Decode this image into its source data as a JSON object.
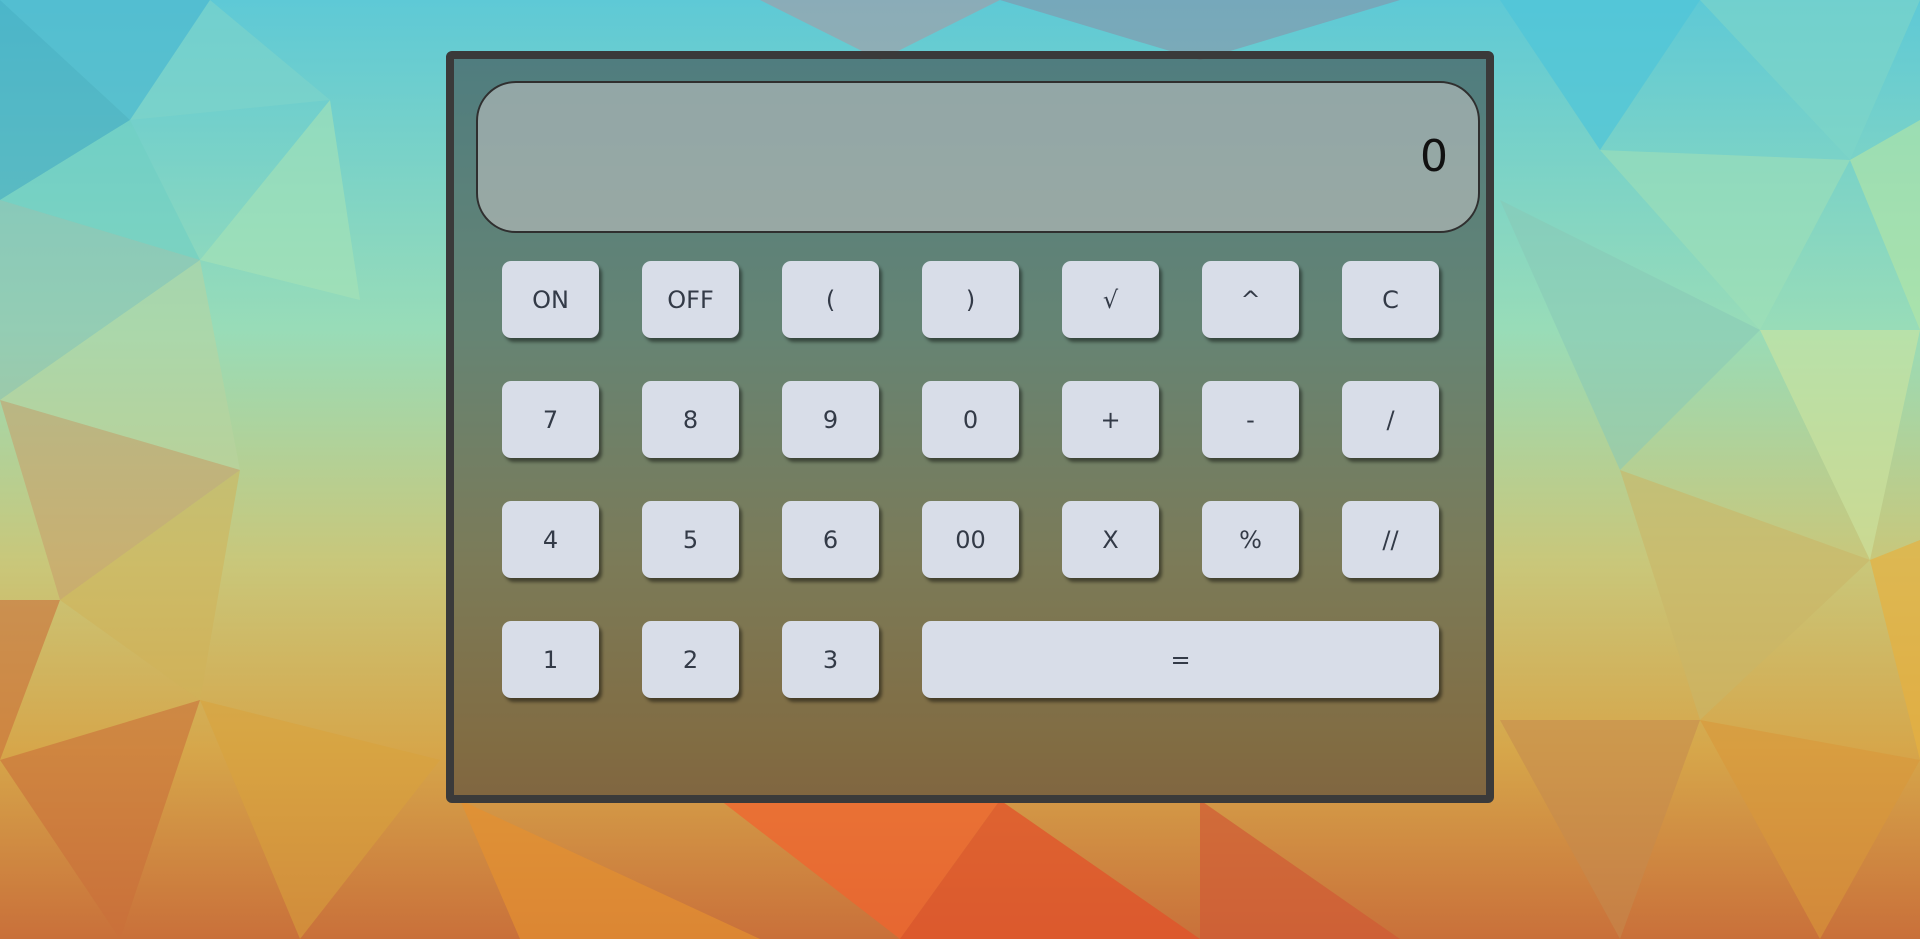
{
  "colors": {
    "frame": "#3a3a3a",
    "panel": "rgba(60,60,60,0.55)",
    "display_bg": "rgba(200,200,200,0.55)",
    "key_bg": "#d8dde8",
    "key_text": "#333a47"
  },
  "calculator": {
    "display_value": "0",
    "rows": [
      [
        "ON",
        "OFF",
        "(",
        ")",
        "√",
        "^",
        "C"
      ],
      [
        "7",
        "8",
        "9",
        "0",
        "+",
        "-",
        "/"
      ],
      [
        "4",
        "5",
        "6",
        "00",
        "X",
        "%",
        "//"
      ],
      [
        "1",
        "2",
        "3",
        "="
      ]
    ]
  }
}
